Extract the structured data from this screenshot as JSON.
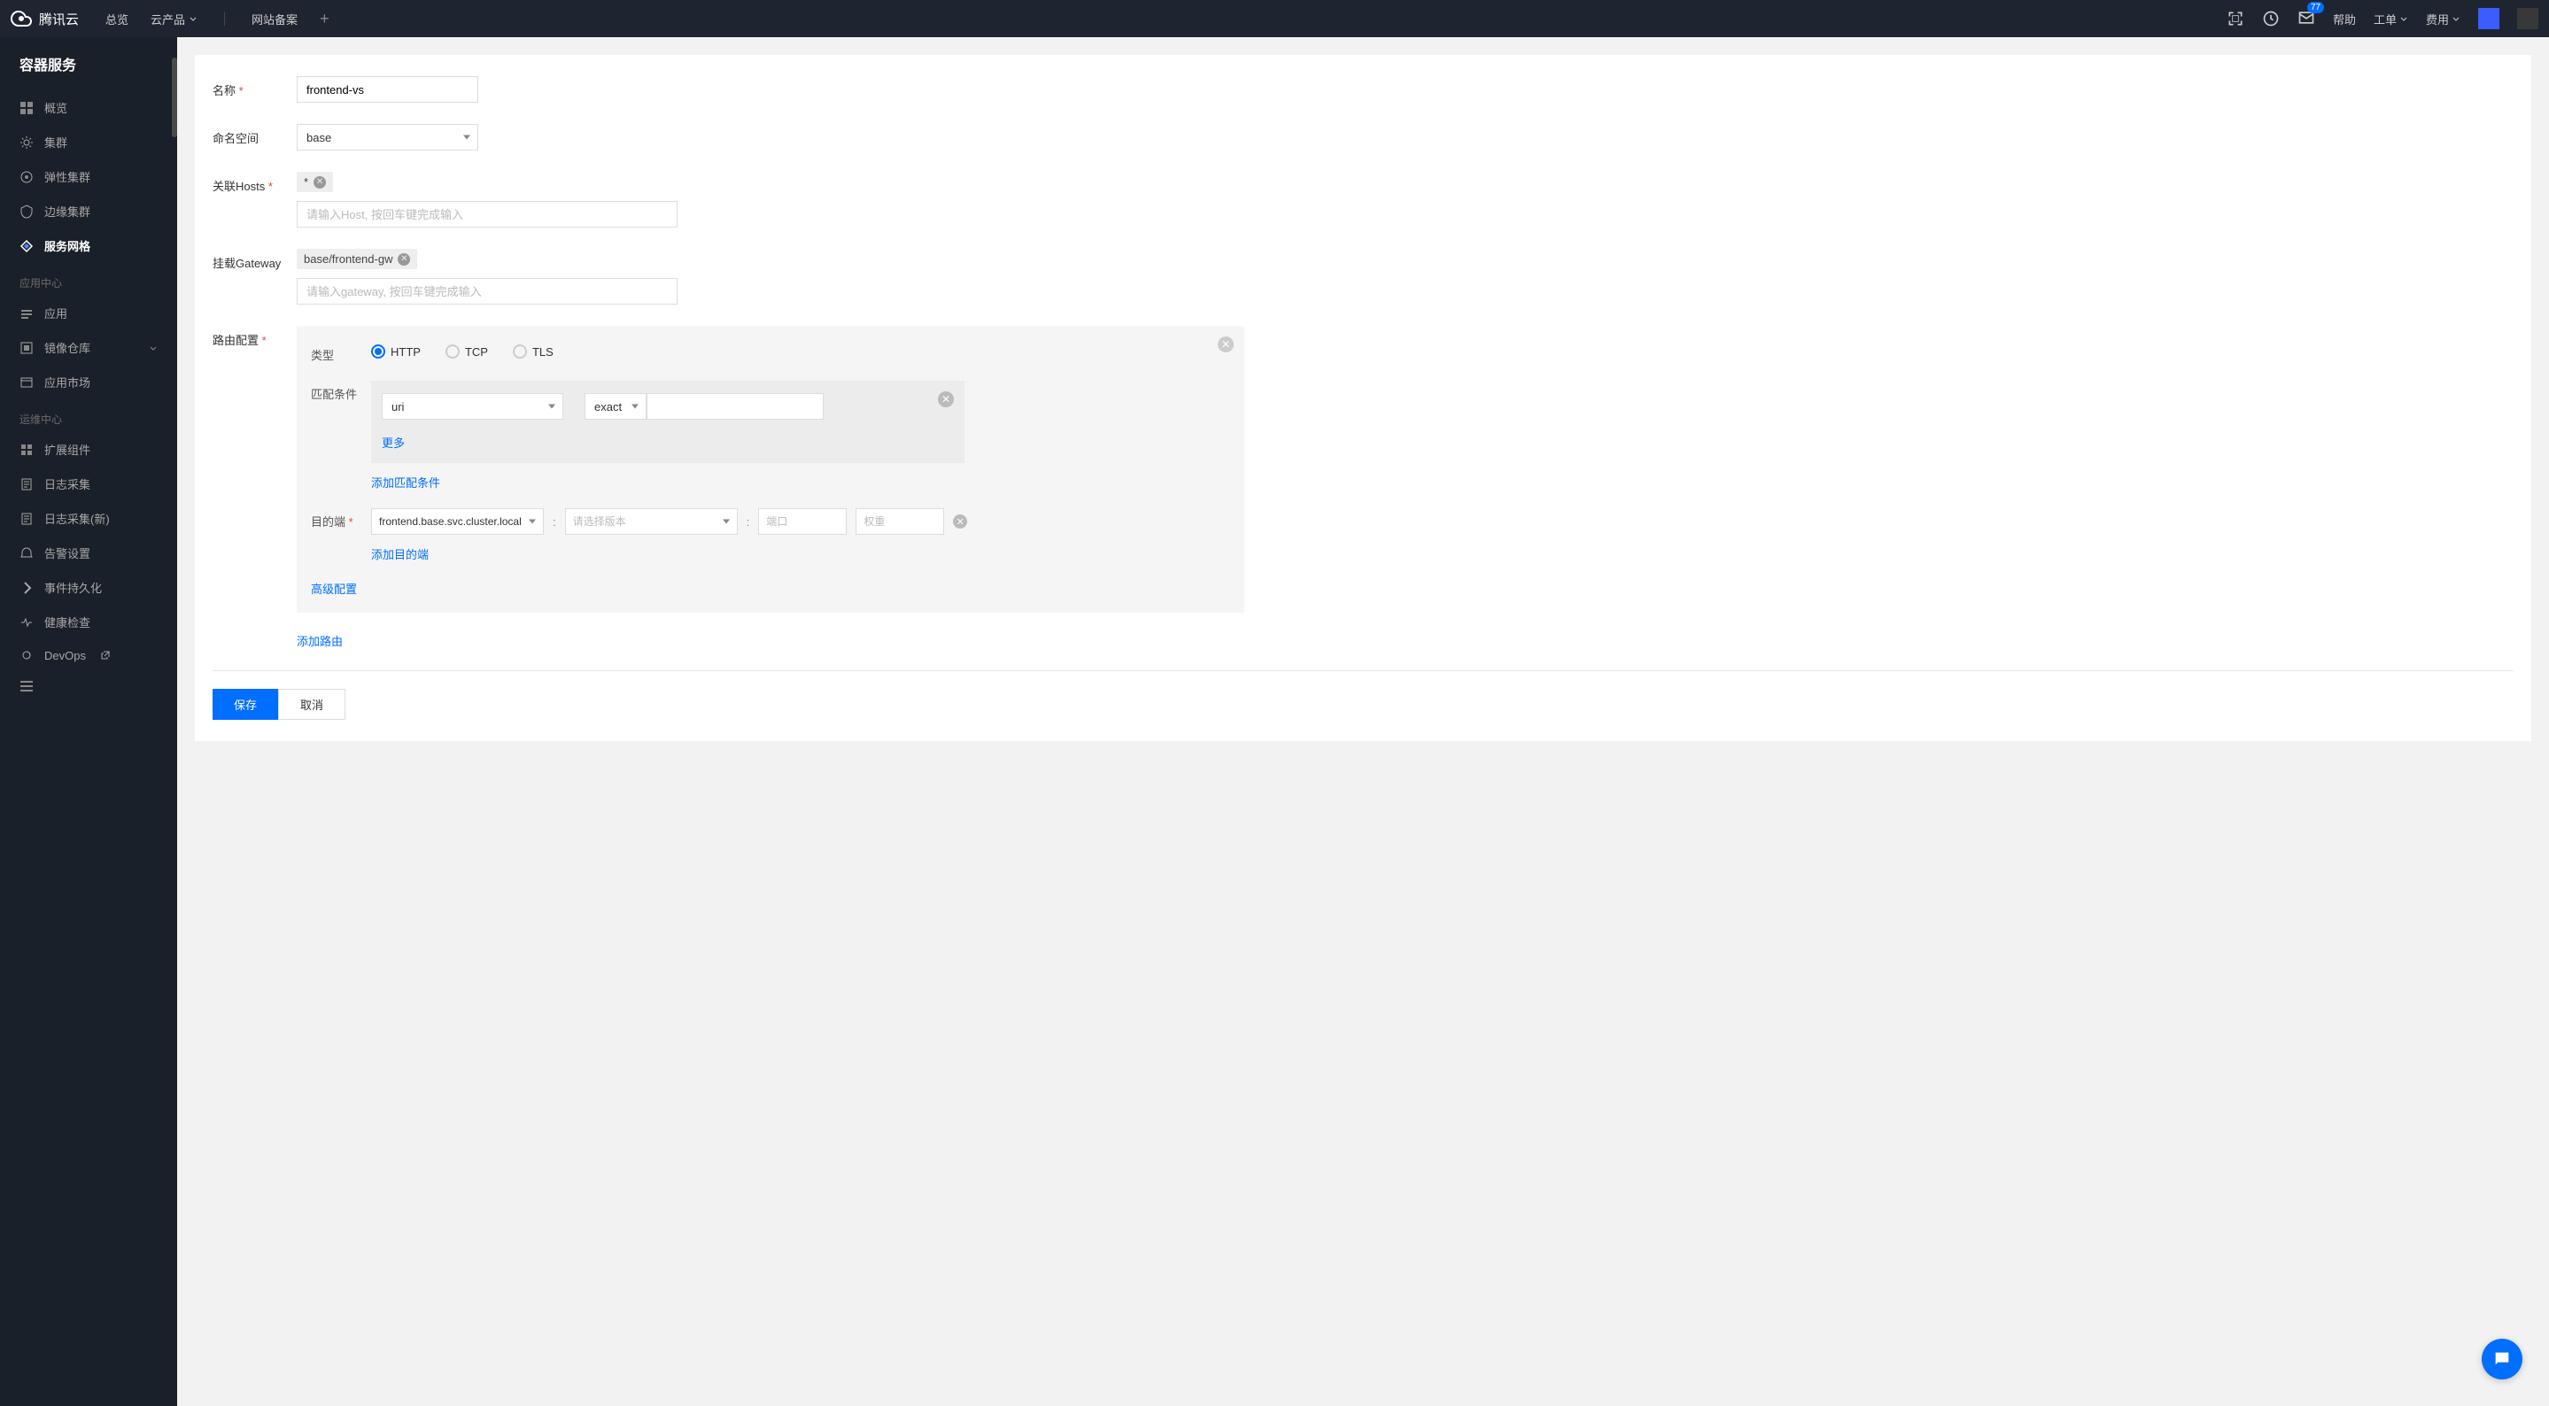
{
  "brand": "腾讯云",
  "top_nav": {
    "overview": "总览",
    "products": "云产品",
    "beian": "网站备案"
  },
  "top_right": {
    "badge": "77",
    "help": "帮助",
    "ticket": "工单",
    "billing": "费用"
  },
  "sidebar": {
    "title": "容器服务",
    "items": [
      {
        "label": "概览"
      },
      {
        "label": "集群"
      },
      {
        "label": "弹性集群"
      },
      {
        "label": "边缘集群"
      },
      {
        "label": "服务网格"
      }
    ],
    "section_app": "应用中心",
    "app_items": [
      {
        "label": "应用"
      },
      {
        "label": "镜像仓库"
      },
      {
        "label": "应用市场"
      }
    ],
    "section_ops": "运维中心",
    "ops_items": [
      {
        "label": "扩展组件"
      },
      {
        "label": "日志采集"
      },
      {
        "label": "日志采集(新)"
      },
      {
        "label": "告警设置"
      },
      {
        "label": "事件持久化"
      },
      {
        "label": "健康检查"
      },
      {
        "label": "DevOps"
      }
    ]
  },
  "form": {
    "name_label": "名称",
    "name_value": "frontend-vs",
    "namespace_label": "命名空间",
    "namespace_value": "base",
    "hosts_label": "关联Hosts",
    "hosts_tag": "*",
    "hosts_placeholder": "请输入Host, 按回车键完成输入",
    "gateway_label": "挂载Gateway",
    "gateway_tag": "base/frontend-gw",
    "gateway_placeholder": "请输入gateway, 按回车键完成输入",
    "route_label": "路由配置",
    "type_label": "类型",
    "type_http": "HTTP",
    "type_tcp": "TCP",
    "type_tls": "TLS",
    "match_label": "匹配条件",
    "match_field": "uri",
    "match_op": "exact",
    "more_link": "更多",
    "add_match": "添加匹配条件",
    "dest_label": "目的端",
    "dest_service": "frontend.base.svc.cluster.local",
    "dest_version_placeholder": "请选择版本",
    "dest_port_placeholder": "端口",
    "dest_weight_placeholder": "权重",
    "add_dest": "添加目的端",
    "advanced": "高级配置",
    "add_route": "添加路由",
    "save": "保存",
    "cancel": "取消"
  }
}
